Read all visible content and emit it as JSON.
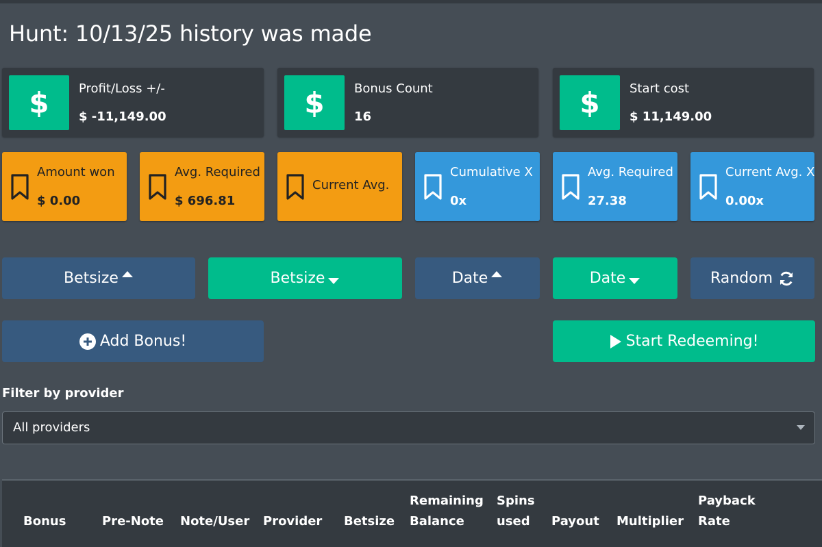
{
  "page_title": "Hunt: 10/13/25 history was made",
  "stats": [
    {
      "label": "Profit/Loss +/-",
      "value": "$ -11,149.00",
      "icon": "dollar-icon"
    },
    {
      "label": "Bonus Count",
      "value": "16",
      "icon": "dollar-icon"
    },
    {
      "label": "Start cost",
      "value": "$ 11,149.00",
      "icon": "dollar-icon"
    }
  ],
  "info_boxes": [
    {
      "label": "Amount won",
      "value": "$ 0.00",
      "color": "#f39c12",
      "icon": "bookmark-icon"
    },
    {
      "label": "Avg. Required",
      "value": "$ 696.81",
      "color": "#f39c12",
      "icon": "bookmark-icon"
    },
    {
      "label": "Current Avg.",
      "value": "",
      "color": "#f39c12",
      "icon": "bookmark-icon"
    },
    {
      "label": "Cumulative X",
      "value": "0x",
      "color": "#3498db",
      "icon": "bookmark-icon"
    },
    {
      "label": "Avg. Required X",
      "value": "27.38",
      "color": "#3498db",
      "icon": "bookmark-icon"
    },
    {
      "label": "Current Avg. X",
      "value": "0.00x",
      "color": "#3498db",
      "icon": "bookmark-icon"
    }
  ],
  "sort_buttons": [
    {
      "label": "Betsize",
      "icon": "caret-up-icon"
    },
    {
      "label": "Betsize",
      "icon": "caret-down-icon"
    },
    {
      "label": "Date",
      "icon": "caret-up-icon"
    },
    {
      "label": "Date",
      "icon": "caret-down-icon"
    },
    {
      "label": "Random",
      "icon": "refresh-icon"
    }
  ],
  "actions": {
    "add_bonus": "Add Bonus!",
    "start_redeeming": "Start Redeeming!"
  },
  "filter": {
    "label": "Filter by provider",
    "selected": "All providers"
  },
  "table": {
    "columns": [
      [
        "Bonus"
      ],
      [
        "Pre-Note"
      ],
      [
        "Note/User"
      ],
      [
        "Provider"
      ],
      [
        "Betsize"
      ],
      [
        "Remaining",
        "Balance"
      ],
      [
        "Spins",
        "used"
      ],
      [
        "Payout"
      ],
      [
        "Multiplier"
      ],
      [
        "Payback",
        "Rate"
      ]
    ]
  },
  "colors": {
    "background": "#454d55",
    "panel": "#343a40",
    "success": "#00bc8c",
    "primary": "#375a7f",
    "warning": "#f39c12",
    "info": "#3498db"
  }
}
